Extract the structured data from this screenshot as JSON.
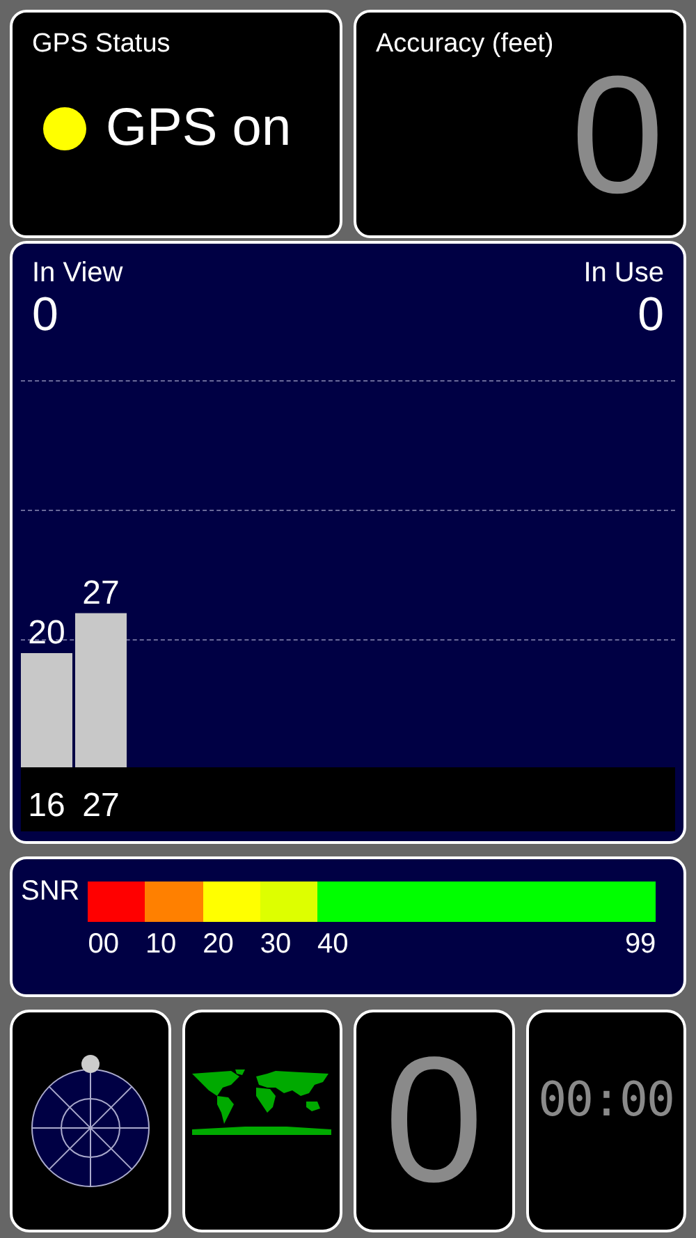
{
  "gps_status": {
    "title": "GPS Status",
    "status": "GPS on",
    "on": true
  },
  "accuracy": {
    "title": "Accuracy (feet)",
    "value": "0"
  },
  "satellites": {
    "in_view_label": "In View",
    "in_view": "0",
    "in_use_label": "In Use",
    "in_use": "0",
    "chart_data": {
      "type": "bar",
      "categories": [
        "16",
        "27"
      ],
      "values": [
        20,
        27
      ],
      "data_labels": true
    }
  },
  "snr": {
    "label": "SNR",
    "ticks": [
      "00",
      "10",
      "20",
      "30",
      "40",
      "99"
    ],
    "segments": [
      {
        "color": "#ff0000"
      },
      {
        "color": "#ff8000"
      },
      {
        "color": "#ffff00"
      },
      {
        "color": "#ddff00"
      },
      {
        "color": "#00ff00"
      }
    ]
  },
  "tiles": [
    {
      "kind": "sky"
    },
    {
      "kind": "map"
    },
    {
      "kind": "digit",
      "value": "0"
    },
    {
      "kind": "clock",
      "value": "00:00"
    }
  ]
}
